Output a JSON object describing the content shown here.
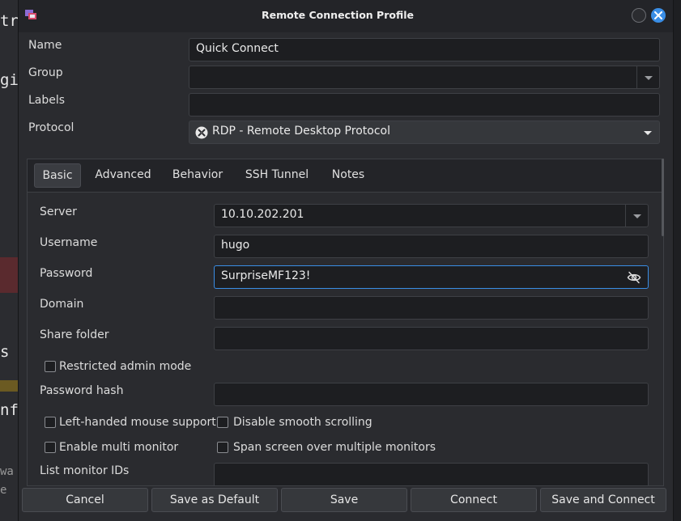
{
  "window": {
    "title": "Remote Connection Profile"
  },
  "background": {
    "fragments": [
      "tr",
      "gi",
      "s",
      "nf",
      "wa",
      "e"
    ]
  },
  "profile": {
    "name_label": "Name",
    "name_value": "Quick Connect",
    "group_label": "Group",
    "group_value": "",
    "labels_label": "Labels",
    "labels_value": "",
    "protocol_label": "Protocol",
    "protocol_value": "RDP - Remote Desktop Protocol"
  },
  "tabs": [
    {
      "label": "Basic",
      "active": true
    },
    {
      "label": "Advanced",
      "active": false
    },
    {
      "label": "Behavior",
      "active": false
    },
    {
      "label": "SSH Tunnel",
      "active": false
    },
    {
      "label": "Notes",
      "active": false
    }
  ],
  "basic": {
    "server_label": "Server",
    "server_value": "10.10.202.201",
    "username_label": "Username",
    "username_value": "hugo",
    "password_label": "Password",
    "password_value": "SurpriseMF123!",
    "domain_label": "Domain",
    "domain_value": "",
    "share_label": "Share folder",
    "share_value": "",
    "restricted_label": "Restricted admin mode",
    "restricted_checked": false,
    "hash_label": "Password hash",
    "hash_value": "",
    "lefthanded_label": "Left-handed mouse support",
    "lefthanded_checked": false,
    "smooth_label": "Disable smooth scrolling",
    "smooth_checked": false,
    "multimon_label": "Enable multi monitor",
    "multimon_checked": false,
    "span_label": "Span screen over multiple monitors",
    "span_checked": false,
    "monitor_ids_label": "List monitor IDs",
    "monitor_ids_value": ""
  },
  "buttons": {
    "cancel": "Cancel",
    "save_default": "Save as Default",
    "save": "Save",
    "connect": "Connect",
    "save_connect": "Save and Connect"
  },
  "icons": {
    "app": "remmina-app-icon",
    "protocol": "rdp-protocol-icon",
    "password_toggle": "eye-slash-icon",
    "close": "close-icon"
  },
  "colors": {
    "accent": "#3a8ee6",
    "window_bg": "#2a2b2f",
    "titlebar_bg": "#232428",
    "field_bg": "#1d1e21"
  }
}
